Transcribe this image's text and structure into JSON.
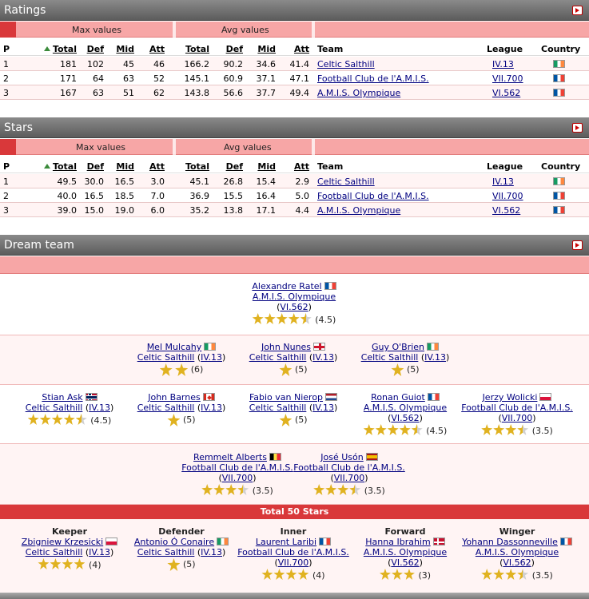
{
  "ratings": {
    "title": "Ratings",
    "group_max": "Max values",
    "group_avg": "Avg values",
    "headers": {
      "p": "P",
      "total": "Total",
      "def": "Def",
      "mid": "Mid",
      "att": "Att",
      "total2": "Total",
      "def2": "Def",
      "mid2": "Mid",
      "att2": "Att",
      "team": "Team",
      "league": "League",
      "country": "Country"
    },
    "rows": [
      {
        "p": "1",
        "max_total": "181",
        "max_def": "102",
        "max_mid": "45",
        "max_att": "46",
        "avg_total": "166.2",
        "avg_def": "90.2",
        "avg_mid": "34.6",
        "avg_att": "41.4",
        "team": "Celtic Salthill",
        "league": "IV.13",
        "flag": "ie"
      },
      {
        "p": "2",
        "max_total": "171",
        "max_def": "64",
        "max_mid": "63",
        "max_att": "52",
        "avg_total": "145.1",
        "avg_def": "60.9",
        "avg_mid": "37.1",
        "avg_att": "47.1",
        "team": "Football Club de l'A.M.I.S.",
        "league": "VII.700",
        "flag": "fr"
      },
      {
        "p": "3",
        "max_total": "167",
        "max_def": "63",
        "max_mid": "51",
        "max_att": "62",
        "avg_total": "143.8",
        "avg_def": "56.6",
        "avg_mid": "37.7",
        "avg_att": "49.4",
        "team": "A.M.I.S. Olympique",
        "league": "VI.562",
        "flag": "fr"
      }
    ]
  },
  "stars": {
    "title": "Stars",
    "group_max": "Max values",
    "group_avg": "Avg values",
    "headers": {
      "p": "P",
      "total": "Total",
      "def": "Def",
      "mid": "Mid",
      "att": "Att",
      "total2": "Total",
      "def2": "Def",
      "mid2": "Mid",
      "att2": "Att",
      "team": "Team",
      "league": "League",
      "country": "Country"
    },
    "rows": [
      {
        "p": "1",
        "max_total": "49.5",
        "max_def": "30.0",
        "max_mid": "16.5",
        "max_att": "3.0",
        "avg_total": "45.1",
        "avg_def": "26.8",
        "avg_mid": "15.4",
        "avg_att": "2.9",
        "team": "Celtic Salthill",
        "league": "IV.13",
        "flag": "ie"
      },
      {
        "p": "2",
        "max_total": "40.0",
        "max_def": "16.5",
        "max_mid": "18.5",
        "max_att": "7.0",
        "avg_total": "36.9",
        "avg_def": "15.5",
        "avg_mid": "16.4",
        "avg_att": "5.0",
        "team": "Football Club de l'A.M.I.S.",
        "league": "VII.700",
        "flag": "fr"
      },
      {
        "p": "3",
        "max_total": "39.0",
        "max_def": "15.0",
        "max_mid": "19.0",
        "max_att": "6.0",
        "avg_total": "35.2",
        "avg_def": "13.8",
        "avg_mid": "17.1",
        "avg_att": "4.4",
        "team": "A.M.I.S. Olympique",
        "league": "VI.562",
        "flag": "fr"
      }
    ]
  },
  "dream_team": {
    "title": "Dream team",
    "total_label": "Total 50 Stars",
    "players": [
      {
        "name": "Alexandre Ratel",
        "flag": "fr",
        "club": "A.M.I.S. Olympique",
        "league": "VI.562",
        "score": "(4.5)",
        "stars": 4.5
      },
      {
        "name": "Mel Mulcahy",
        "flag": "ie",
        "club": "Celtic Salthill",
        "league": "IV.13",
        "score": "(6)",
        "stars": 6
      },
      {
        "name": "John Nunes",
        "flag": "gb",
        "club": "Celtic Salthill",
        "league": "IV.13",
        "score": "(5)",
        "stars": 5
      },
      {
        "name": "Guy O'Brien",
        "flag": "ie",
        "club": "Celtic Salthill",
        "league": "IV.13",
        "score": "(5)",
        "stars": 5
      },
      {
        "name": "Stian Ask",
        "flag": "no",
        "club": "Celtic Salthill",
        "league": "IV.13",
        "score": "(4.5)",
        "stars": 4.5
      },
      {
        "name": "John Barnes",
        "flag": "ca",
        "club": "Celtic Salthill",
        "league": "IV.13",
        "score": "(5)",
        "stars": 5
      },
      {
        "name": "Fabio van Nierop",
        "flag": "nl",
        "club": "Celtic Salthill",
        "league": "IV.13",
        "score": "(5)",
        "stars": 5
      },
      {
        "name": "Ronan Guiot",
        "flag": "fr",
        "club": "A.M.I.S. Olympique",
        "league": "VI.562",
        "score": "(4.5)",
        "stars": 4.5
      },
      {
        "name": "Jerzy Wolicki",
        "flag": "pl",
        "club": "Football Club de l'A.M.I.S.",
        "league": "VII.700",
        "score": "(3.5)",
        "stars": 3.5
      },
      {
        "name": "Remmelt Alberts",
        "flag": "be",
        "club": "Football Club de l'A.M.I.S.",
        "league": "VII.700",
        "score": "(3.5)",
        "stars": 3.5
      },
      {
        "name": "José Usón",
        "flag": "es",
        "club": "Football Club de l'A.M.I.S.",
        "league": "VII.700",
        "score": "(3.5)",
        "stars": 3.5
      }
    ],
    "roles": [
      {
        "role": "Keeper",
        "name": "Zbigniew Krzesicki",
        "flag": "pl",
        "club": "Celtic Salthill",
        "league": "IV.13",
        "score": "(4)",
        "stars": 4
      },
      {
        "role": "Defender",
        "name": "Antonio Ó Conaire",
        "flag": "ie",
        "club": "Celtic Salthill",
        "league": "IV.13",
        "score": "(5)",
        "stars": 5
      },
      {
        "role": "Inner",
        "name": "Laurent Laribi",
        "flag": "fr",
        "club": "Football Club de l'A.M.I.S.",
        "league": "VII.700",
        "score": "(4)",
        "stars": 4
      },
      {
        "role": "Forward",
        "name": "Hanna Ibrahim",
        "flag": "dk",
        "club": "A.M.I.S. Olympique",
        "league": "VI.562",
        "score": "(3)",
        "stars": 3
      },
      {
        "role": "Winger",
        "name": "Yohann Dassonneville",
        "flag": "fr",
        "club": "A.M.I.S. Olympique",
        "league": "VI.562",
        "score": "(3.5)",
        "stars": 3.5
      }
    ]
  }
}
